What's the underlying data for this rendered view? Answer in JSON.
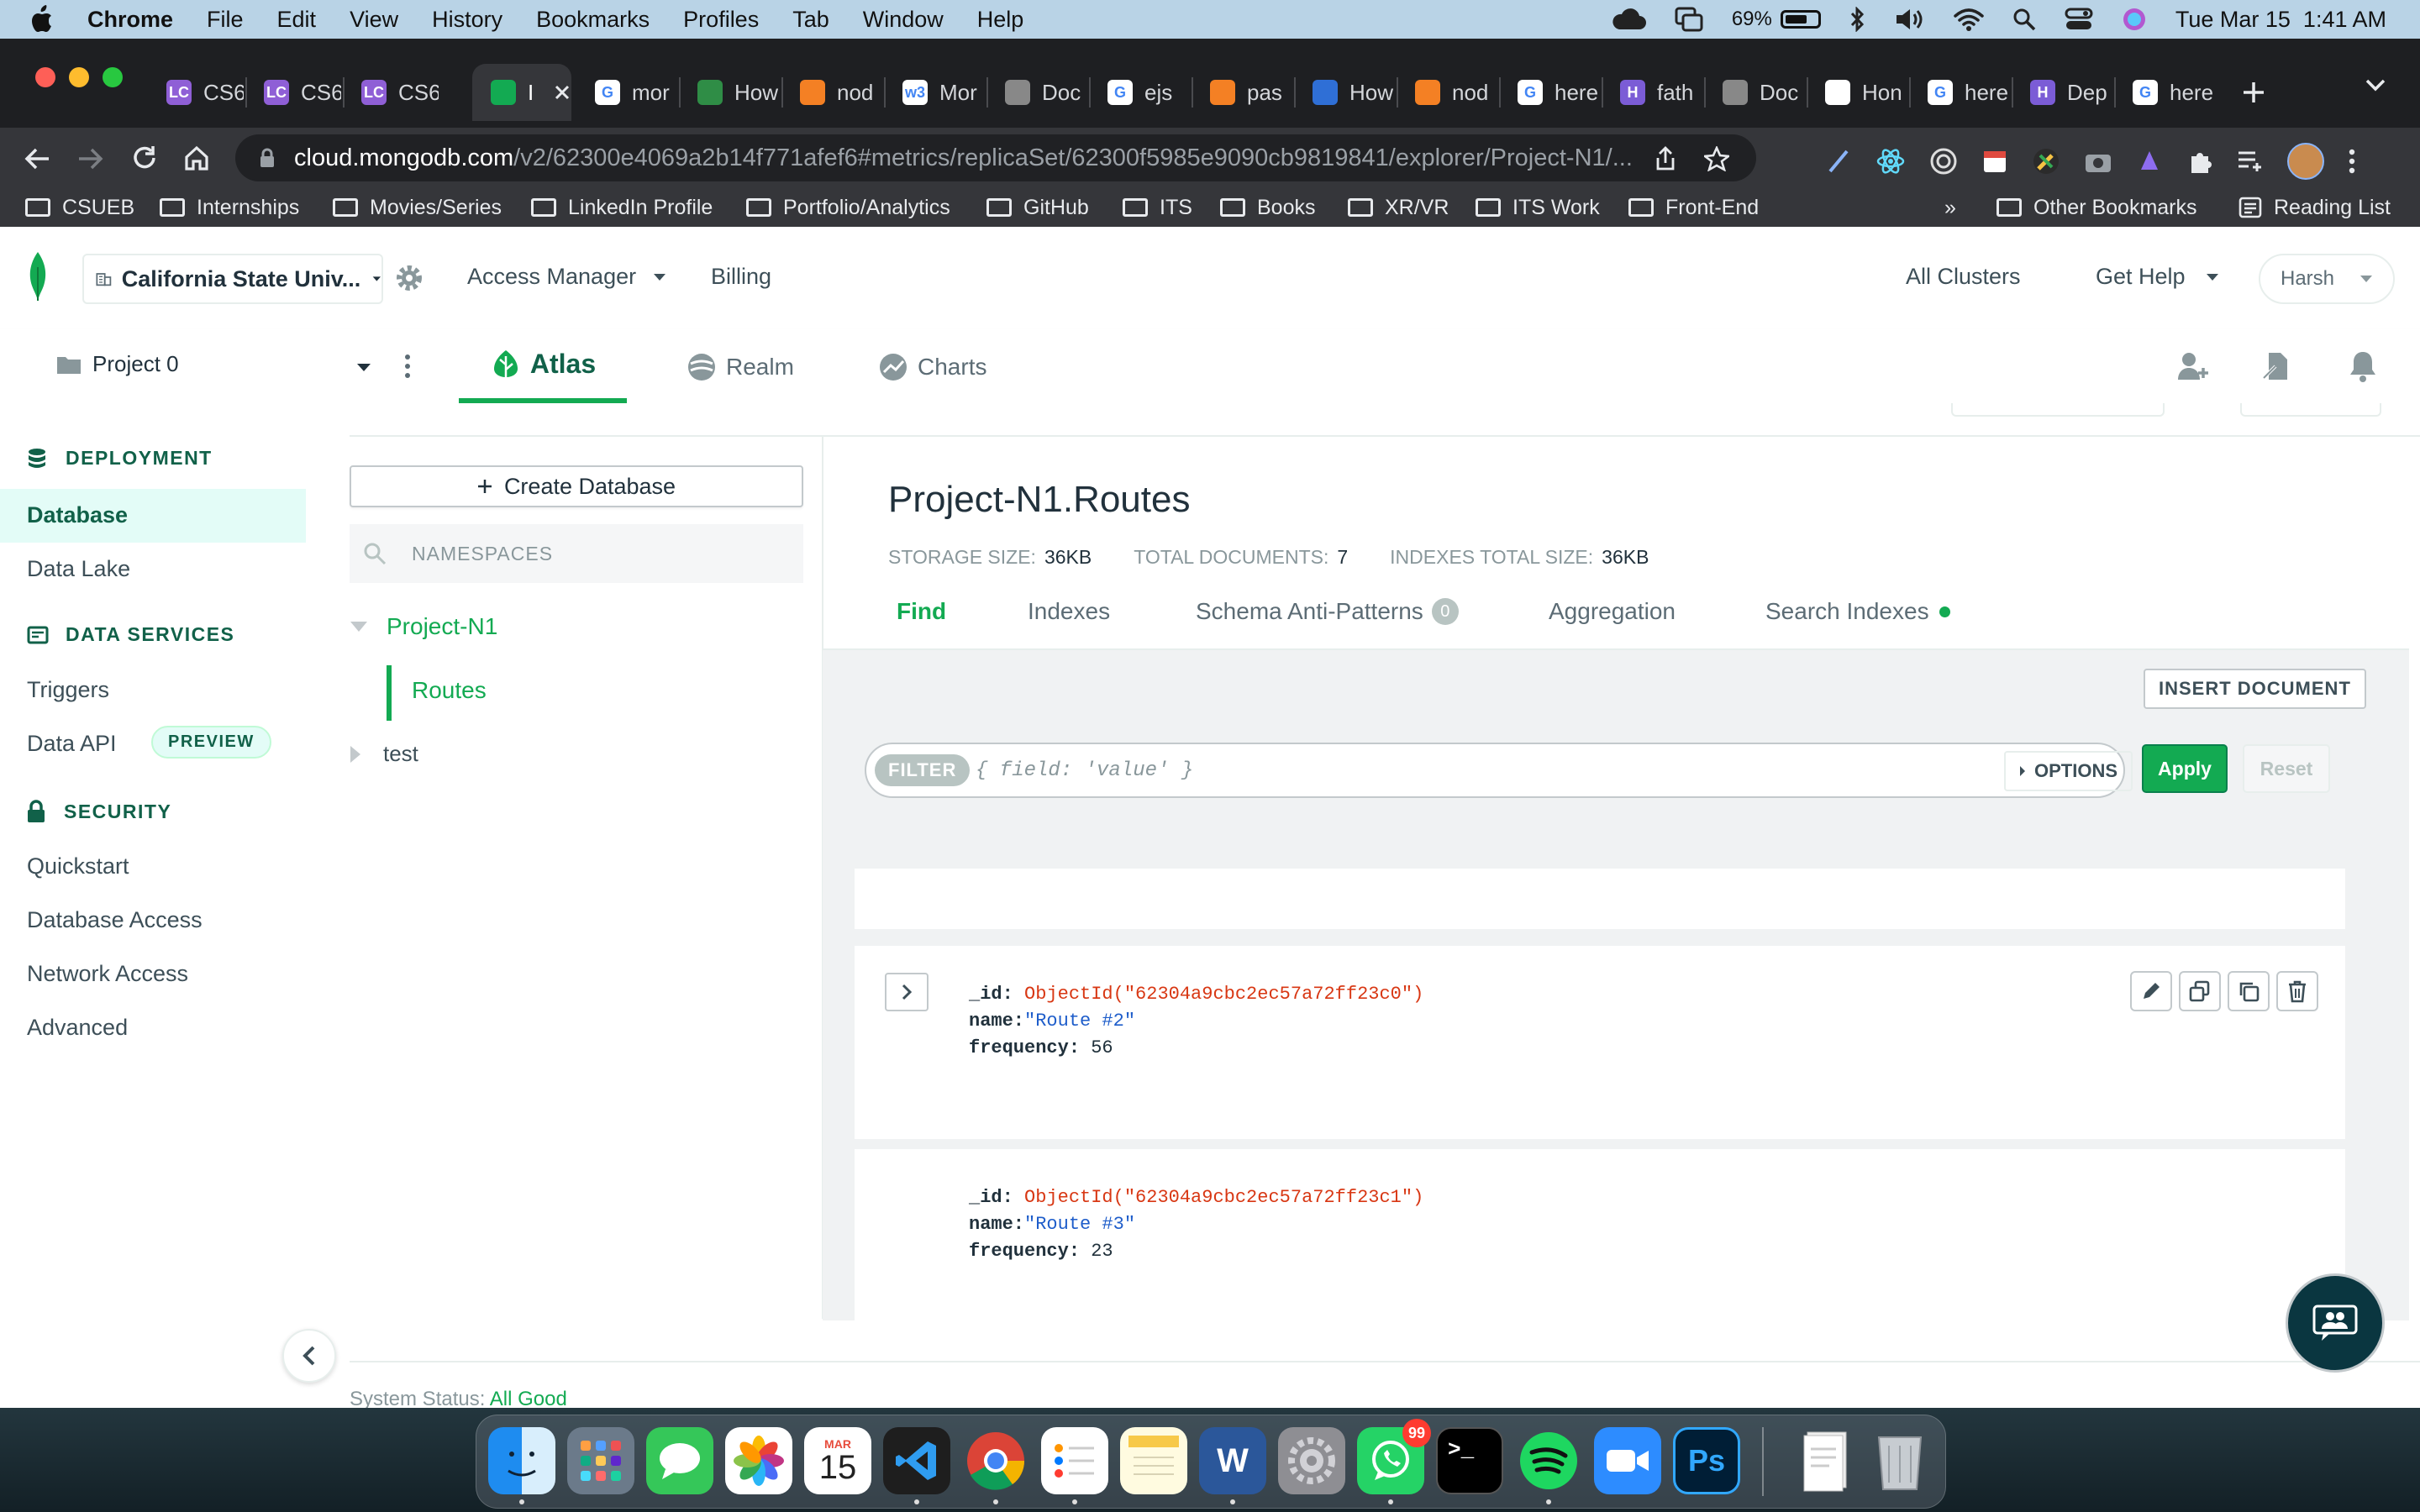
{
  "menubar": {
    "app_name": "Chrome",
    "menus": [
      "File",
      "Edit",
      "View",
      "History",
      "Bookmarks",
      "Profiles",
      "Tab",
      "Window",
      "Help"
    ],
    "battery_percent": "69%",
    "battery_level": 0.69,
    "datetime": "Tue Mar 15  1:41 AM"
  },
  "browser": {
    "tabs": [
      {
        "title": "CS6",
        "favicon": "Lc",
        "color": "#8f5fd6"
      },
      {
        "title": "CS6",
        "favicon": "Lc",
        "color": "#8f5fd6"
      },
      {
        "title": "CS6",
        "favicon": "Lc",
        "color": "#8f5fd6"
      },
      {
        "title": "I",
        "favicon": "leaf",
        "color": "#13aa52",
        "active": true
      },
      {
        "title": "mor",
        "favicon": "G",
        "color": "#ffffff"
      },
      {
        "title": "How",
        "favicon": "gfg",
        "color": "#2f8d46"
      },
      {
        "title": "nod",
        "favicon": "so",
        "color": "#f48024"
      },
      {
        "title": "Mor",
        "favicon": "w3",
        "color": "#ffffff"
      },
      {
        "title": "Doc",
        "favicon": "globe",
        "color": "#888888"
      },
      {
        "title": "ejs",
        "favicon": "G",
        "color": "#ffffff"
      },
      {
        "title": "pas",
        "favicon": "so",
        "color": "#f48024"
      },
      {
        "title": "How",
        "favicon": "o",
        "color": "#2f6fd6"
      },
      {
        "title": "nod",
        "favicon": "so",
        "color": "#f48024"
      },
      {
        "title": "here",
        "favicon": "G",
        "color": "#ffffff"
      },
      {
        "title": "fath",
        "favicon": "H",
        "color": "#7b5cd6"
      },
      {
        "title": "Doc",
        "favicon": "globe",
        "color": "#888888"
      },
      {
        "title": "Hon",
        "favicon": "gh",
        "color": "#ffffff"
      },
      {
        "title": "here",
        "favicon": "G",
        "color": "#ffffff"
      },
      {
        "title": "Dep",
        "favicon": "H",
        "color": "#7b5cd6"
      },
      {
        "title": "here",
        "favicon": "G",
        "color": "#ffffff"
      }
    ],
    "url_host": "cloud.mongodb.com",
    "url_path": "/v2/62300e4069a2b14f771afef6#metrics/replicaSet/62300f5985e9090cb9819841/explorer/Project-N1/...",
    "bookmarks": [
      "CSUEB",
      "Internships",
      "Movies/Series",
      "LinkedIn Profile",
      "Portfolio/Analytics",
      "GitHub",
      "ITS",
      "Books",
      "XR/VR",
      "ITS Work",
      "Front-End"
    ],
    "overflow": "»",
    "other_bookmarks": "Other Bookmarks",
    "reading_list": "Reading List"
  },
  "atlas": {
    "org_name": "California State Univ...",
    "access_manager": "Access Manager",
    "billing": "Billing",
    "all_clusters": "All Clusters",
    "get_help": "Get Help",
    "user": "Harsh",
    "project": "Project 0",
    "nav_tabs": [
      "Atlas",
      "Realm",
      "Charts"
    ],
    "accent": "#13aa52"
  },
  "sidebar": {
    "deployment_label": "DEPLOYMENT",
    "deployment_items": [
      "Database",
      "Data Lake"
    ],
    "data_services_label": "DATA SERVICES",
    "triggers": "Triggers",
    "data_api": "Data API",
    "preview_badge": "PREVIEW",
    "security_label": "SECURITY",
    "security_items": [
      "Quickstart",
      "Database Access",
      "Network Access",
      "Advanced"
    ]
  },
  "namespaces": {
    "create_db": "Create Database",
    "search_placeholder": "NAMESPACES",
    "db1": "Project-N1",
    "collection": "Routes",
    "db2": "test"
  },
  "collection": {
    "title": "Project-N1.Routes",
    "storage_label": "STORAGE SIZE:",
    "storage_value": "36KB",
    "docs_label": "TOTAL DOCUMENTS:",
    "docs_value": "7",
    "indexes_label": "INDEXES TOTAL SIZE:",
    "indexes_value": "36KB",
    "tabs": {
      "find": "Find",
      "indexes": "Indexes",
      "schema": "Schema Anti-Patterns",
      "schema_count": "0",
      "aggregation": "Aggregation",
      "search": "Search Indexes"
    },
    "insert_document": "INSERT DOCUMENT",
    "filter_label": "FILTER",
    "filter_placeholder": "{ field: 'value' }",
    "options": "OPTIONS",
    "apply": "Apply",
    "reset": "Reset",
    "documents": [
      {
        "id_key": "_id:",
        "id": "ObjectId(\"62304a9cbc2ec57a72ff23c0\")",
        "name_key": "name:",
        "name": "\"Route #2\"",
        "freq_key": "frequency:",
        "frequency": "56"
      },
      {
        "id_key": "_id:",
        "id": "ObjectId(\"62304a9cbc2ec57a72ff23c1\")",
        "name_key": "name:",
        "name": "\"Route #3\"",
        "freq_key": "frequency:",
        "frequency": "23"
      }
    ]
  },
  "footer": {
    "status_label": "System Status:",
    "status_value": "All Good"
  },
  "dock": {
    "calendar_month": "MAR",
    "calendar_day": "15",
    "whatsapp_badge": "99"
  }
}
